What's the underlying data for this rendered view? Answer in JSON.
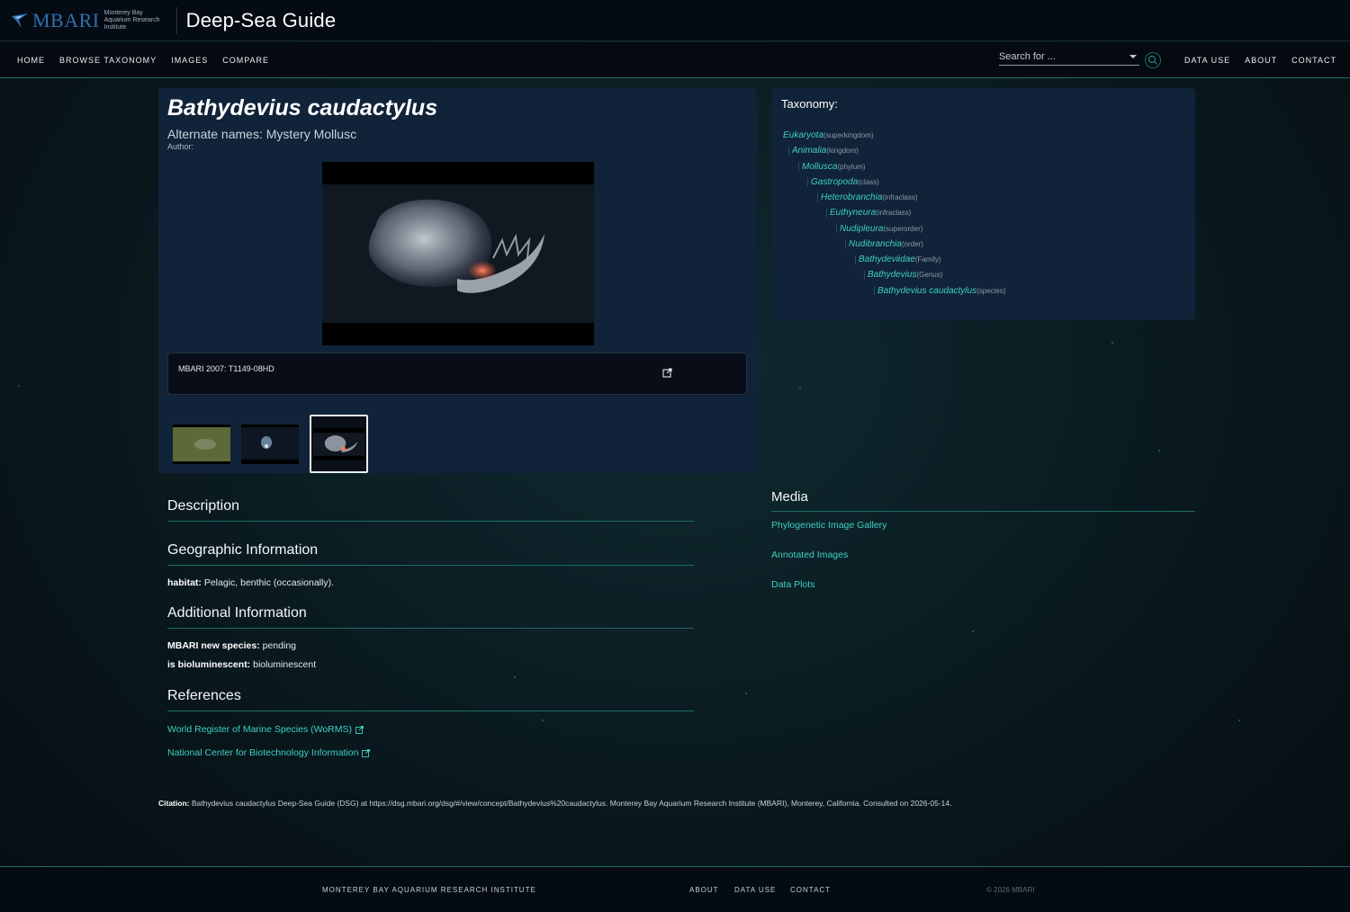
{
  "brand": {
    "logo_word": "MBARI",
    "logo_sub": "Monterey Bay Aquarium Research Institute",
    "app_title": "Deep-Sea Guide"
  },
  "nav": {
    "left": [
      "HOME",
      "BROWSE TAXONOMY",
      "IMAGES",
      "COMPARE"
    ],
    "search_placeholder": "Search for ...",
    "right": [
      "DATA USE",
      "ABOUT",
      "CONTACT"
    ]
  },
  "species": {
    "title": "Bathydevius caudactylus",
    "alt_names": "Alternate names: Mystery Mollusc",
    "author": "Author:",
    "caption": "MBARI 2007: T1149-08HD"
  },
  "taxonomy": {
    "heading": "Taxonomy:",
    "rows": [
      {
        "name": "Eukaryota",
        "rank": "(superkingdom)"
      },
      {
        "name": "Animalia",
        "rank": "(kingdom)"
      },
      {
        "name": "Mollusca",
        "rank": "(phylum)"
      },
      {
        "name": "Gastropoda",
        "rank": "(class)"
      },
      {
        "name": "Heterobranchia",
        "rank": "(infraclass)"
      },
      {
        "name": "Euthyneura",
        "rank": "(infraclass)"
      },
      {
        "name": "Nudipleura",
        "rank": "(superorder)"
      },
      {
        "name": "Nudibranchia",
        "rank": "(order)"
      },
      {
        "name": "Bathydeviidae",
        "rank": "(Family)"
      },
      {
        "name": "Bathydevius",
        "rank": "(Genus)"
      },
      {
        "name": "Bathydevius caudactylus",
        "rank": "(species)"
      }
    ]
  },
  "description": {
    "title": "Description"
  },
  "geographic": {
    "title": "Geographic Information",
    "habitat_label": "habitat:",
    "habitat_value": "Pelagic, benthic (occasionally)."
  },
  "additional": {
    "title": "Additional Information",
    "new_species_label": "MBARI new species:",
    "new_species_value": "pending",
    "biolum_label": "is bioluminescent:",
    "biolum_value": "bioluminescent"
  },
  "references": {
    "title": "References",
    "links": [
      "World Register of Marine Species (WoRMS)",
      "National Center for Biotechnology Information"
    ]
  },
  "media": {
    "title": "Media",
    "links": [
      "Phylogenetic Image Gallery",
      "Annotated Images",
      "Data Plots"
    ]
  },
  "citation": {
    "label": "Citation:",
    "text": "Bathydevius caudactylus Deep-Sea Guide (DSG) at https://dsg.mbari.org/dsg/#/view/concept/Bathydevius%20caudactylus. Monterey Bay Aquarium Research Institute (MBARI), Monterey, California. Consulted on 2026-05-14."
  },
  "footer": {
    "org": "MONTEREY BAY AQUARIUM RESEARCH INSTITUTE",
    "links": [
      "ABOUT",
      "DATA USE",
      "CONTACT"
    ],
    "copyright": "© 2026 MBARI"
  },
  "colors": {
    "accent": "#3fd0c0",
    "card": "#102338",
    "topbar": "#050b12"
  }
}
